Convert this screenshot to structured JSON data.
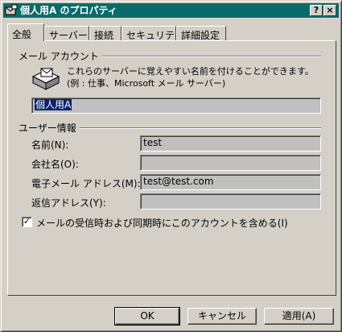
{
  "window": {
    "title": "個人用A のプロパティ",
    "help_glyph": "?",
    "close_glyph": "×"
  },
  "tabs": [
    {
      "label": "全般",
      "active": true
    },
    {
      "label": "サーバー",
      "active": false
    },
    {
      "label": "接続",
      "active": false
    },
    {
      "label": "セキュリティ",
      "active": false
    },
    {
      "label": "詳細設定",
      "active": false
    }
  ],
  "mail_account": {
    "section_label": "メール アカウント",
    "description": "これらのサーバーに覚えやすい名前を付けることができます。(例 : 仕事、Microsoft メール サーバー)",
    "account_name": "個人用A"
  },
  "user_info": {
    "section_label": "ユーザー情報",
    "name_label": "名前(N):",
    "name_value": "test",
    "company_label": "会社名(O):",
    "company_value": "",
    "email_label": "電子メール アドレス(M):",
    "email_value": "test@test.com",
    "reply_label": "返信アドレス(Y):",
    "reply_value": ""
  },
  "include_checkbox": {
    "label": "メールの受信時および同期時にこのアカウントを含める(I)",
    "checked_glyph": "✓"
  },
  "buttons": {
    "ok": "OK",
    "cancel": "キャンセル",
    "apply": "適用(A)"
  }
}
